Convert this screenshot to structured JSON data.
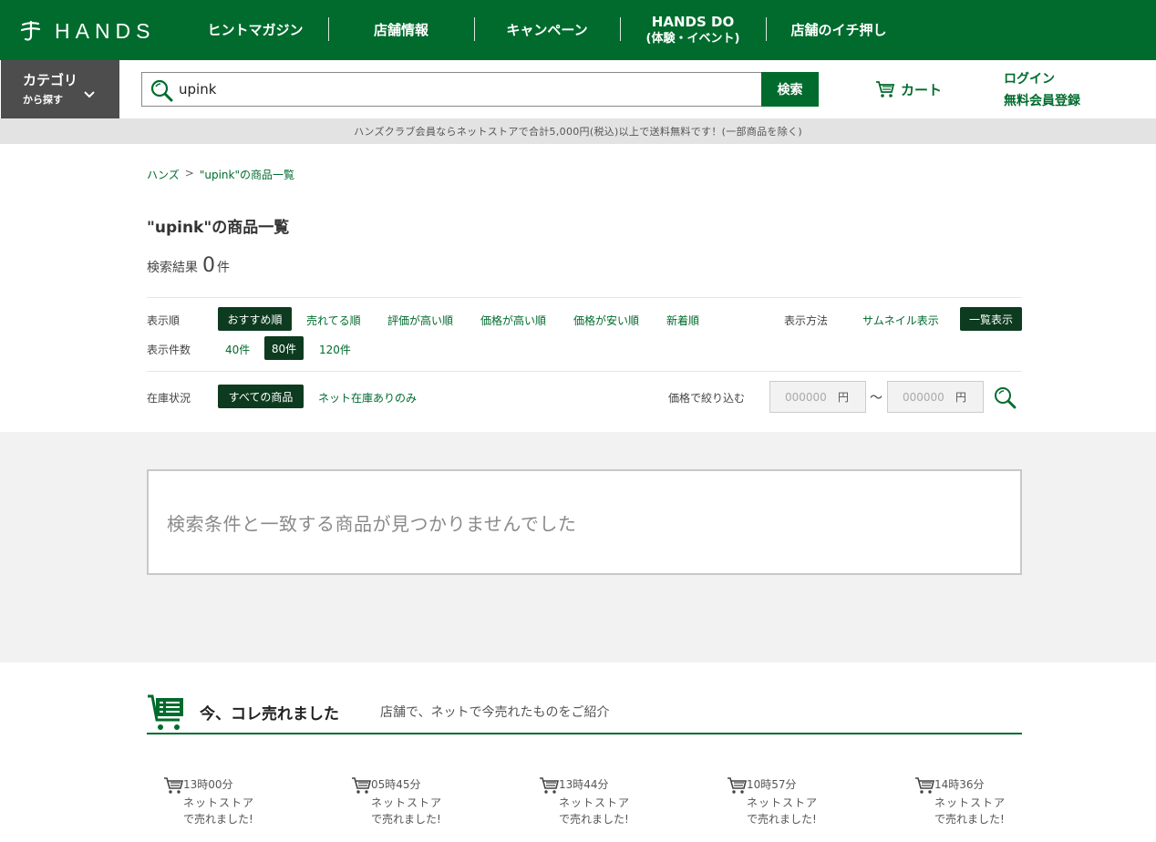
{
  "brand": {
    "name": "HANDS",
    "color": "#006b2d"
  },
  "nav": [
    {
      "label": "ヒントマガジン"
    },
    {
      "label": "店舗情報"
    },
    {
      "label": "キャンペーン"
    },
    {
      "label": "HANDS DO",
      "sub": "(体験・イベント)"
    },
    {
      "label": "店舗のイチ押し"
    }
  ],
  "category": {
    "label": "カテゴリ",
    "sub": "から探す"
  },
  "search": {
    "value": "upink",
    "button": "検索"
  },
  "cart": {
    "label": "カート"
  },
  "account": {
    "login": "ログイン",
    "register": "無料会員登録"
  },
  "notice": "ハンズクラブ会員ならネットストアで合計5,000円(税込)以上で送料無料です！(一部商品を除く)",
  "breadcrumb": {
    "home": "ハンズ",
    "sep": ">",
    "current": "\"upink\"の商品一覧"
  },
  "page_title": "\"upink\"の商品一覧",
  "result": {
    "label": "検索結果",
    "count": "0",
    "unit": "件"
  },
  "sort": {
    "label": "表示順",
    "options": [
      "おすすめ順",
      "売れてる順",
      "評価が高い順",
      "価格が高い順",
      "価格が安い順",
      "新着順"
    ],
    "active": "おすすめ順"
  },
  "view": {
    "label": "表示方法",
    "options": [
      "サムネイル表示",
      "一覧表示"
    ],
    "active": "一覧表示"
  },
  "per_page": {
    "label": "表示件数",
    "options": [
      "40件",
      "80件",
      "120件"
    ],
    "active": "80件"
  },
  "stock": {
    "label": "在庫状況",
    "options": [
      "すべての商品",
      "ネット在庫ありのみ"
    ],
    "active": "すべての商品"
  },
  "price_filter": {
    "label": "価格で絞り込む",
    "min_placeholder": "000000",
    "max_placeholder": "000000",
    "unit": "円",
    "tilde": "〜"
  },
  "empty_message": "検索条件と一致する商品が見つかりませんでした",
  "sold_now": {
    "title": "今、コレ売れました",
    "subtitle": "店舗で、ネットで今売れたものをご紹介",
    "items": [
      {
        "time": "13時00分",
        "where": "ネットストア",
        "msg": "で売れました!"
      },
      {
        "time": "05時45分",
        "where": "ネットストア",
        "msg": "で売れました!"
      },
      {
        "time": "13時44分",
        "where": "ネットストア",
        "msg": "で売れました!"
      },
      {
        "time": "10時57分",
        "where": "ネットストア",
        "msg": "で売れました!"
      },
      {
        "time": "14時36分",
        "where": "ネットストア",
        "msg": "で売れました!"
      }
    ]
  }
}
